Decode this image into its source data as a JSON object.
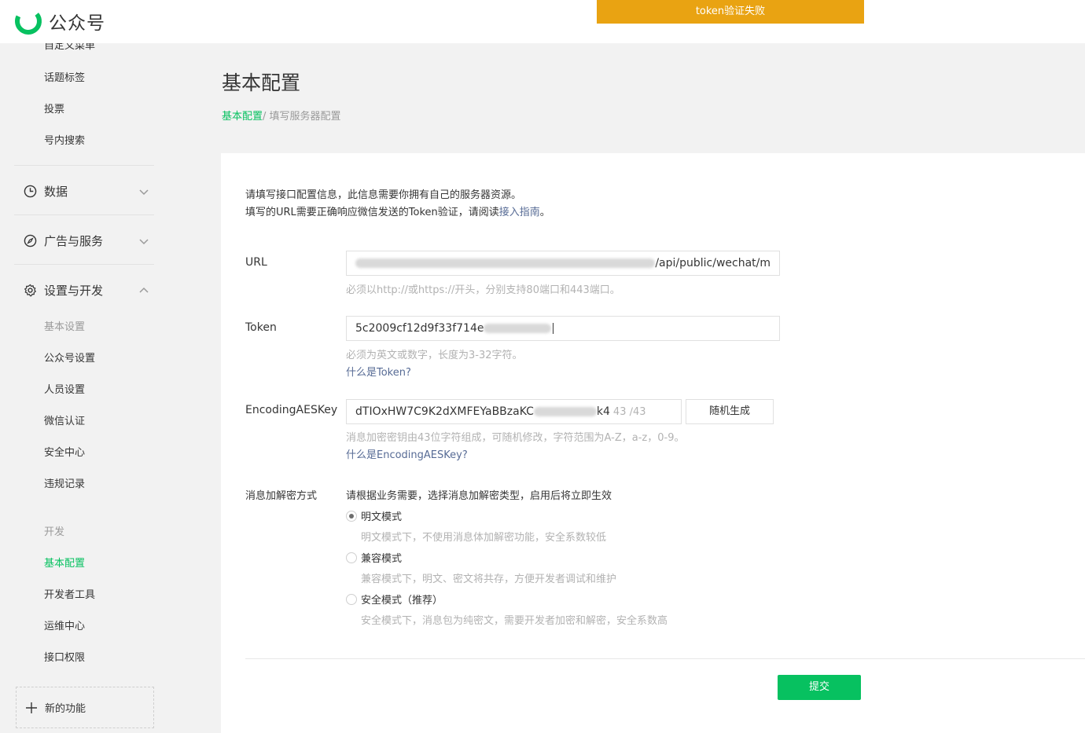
{
  "app": {
    "name": "公众号"
  },
  "toast": {
    "message": "token验证失败"
  },
  "sidebar": {
    "top_items": [
      "自定义菜单",
      "话题标签",
      "投票",
      "号内搜索"
    ],
    "groups": [
      {
        "label": "数据",
        "icon": "chart-clock-icon",
        "expanded": false
      },
      {
        "label": "广告与服务",
        "icon": "compass-icon",
        "expanded": false
      },
      {
        "label": "设置与开发",
        "icon": "gear-icon",
        "expanded": true
      }
    ],
    "settings_section": "基本设置",
    "settings_items": [
      "公众号设置",
      "人员设置",
      "微信认证",
      "安全中心",
      "违规记录"
    ],
    "dev_section": "开发",
    "dev_items": [
      "基本配置",
      "开发者工具",
      "运维中心",
      "接口权限"
    ],
    "new_feature": "新的功能",
    "accent_color": "#07c160"
  },
  "header": {
    "title": "基本配置",
    "breadcrumb": {
      "link": "基本配置",
      "separator": "/ ",
      "current": "填写服务器配置"
    }
  },
  "form": {
    "intro_line1": "请填写接口配置信息，此信息需要你拥有自己的服务器资源。",
    "intro_line2_prefix": "填写的URL需要正确响应微信发送的Token验证，请阅读",
    "intro_link": "接入指南",
    "intro_line2_suffix": "。",
    "url": {
      "label": "URL",
      "value_visible": "/api/public/wechat/m",
      "hint": "必须以http://或https://开头，分别支持80端口和443端口。"
    },
    "token": {
      "label": "Token",
      "value_visible": "5c2009cf12d9f33f714e",
      "hint": "必须为英文或数字，长度为3-32字符。",
      "help_link": "什么是Token?"
    },
    "aes": {
      "label": "EncodingAESKey",
      "value_visible_prefix": "dTIOxHW7C9K2dXMFEYaBBzaKC",
      "value_visible_suffix": "k4",
      "count": "43 ∕43",
      "generate_button": "随机生成",
      "hint": "消息加密密钥由43位字符组成，可随机修改，字符范围为A-Z，a-z，0-9。",
      "help_link": "什么是EncodingAESKey?"
    },
    "encryption": {
      "label": "消息加解密方式",
      "description": "请根据业务需要，选择消息加解密类型，启用后将立即生效",
      "options": [
        {
          "label": "明文模式",
          "desc": "明文模式下，不使用消息体加解密功能，安全系数较低",
          "checked": true
        },
        {
          "label": "兼容模式",
          "desc": "兼容模式下，明文、密文将共存，方便开发者调试和维护",
          "checked": false
        },
        {
          "label": "安全模式（推荐）",
          "desc": "安全模式下，消息包为纯密文，需要开发者加密和解密，安全系数高",
          "checked": false
        }
      ]
    },
    "submit": "提交"
  }
}
